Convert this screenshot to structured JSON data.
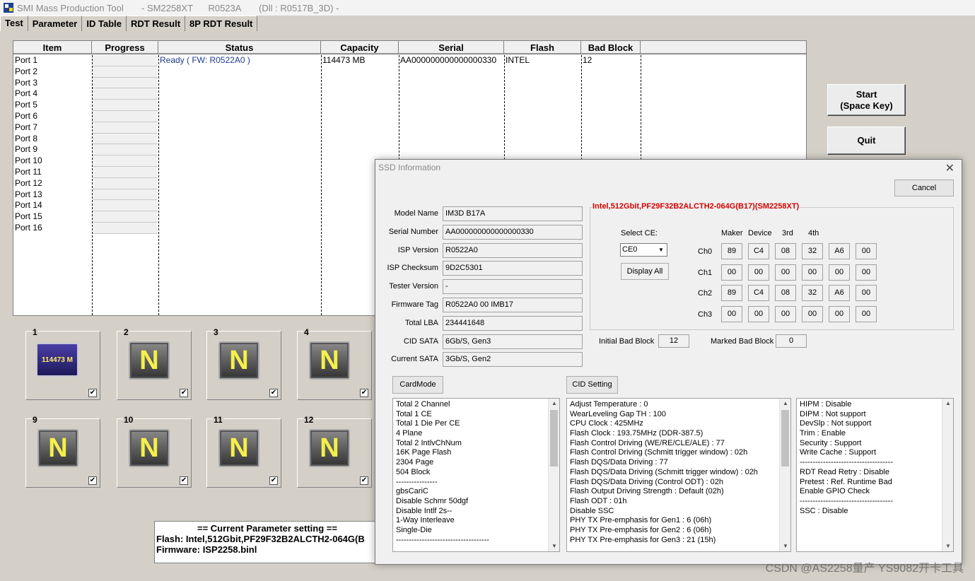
{
  "window": {
    "title": "SMI Mass Production Tool       - SM2258XT      R0523A       (Dll : R0517B_3D) -"
  },
  "tabs": [
    "Test",
    "Parameter",
    "ID Table",
    "RDT Result",
    "8P RDT Result"
  ],
  "table": {
    "headers": {
      "item": "Item",
      "progress": "Progress",
      "status": "Status",
      "capacity": "Capacity",
      "serial": "Serial",
      "flash": "Flash",
      "bad": "Bad Block"
    },
    "rows": [
      {
        "item": "Port 1",
        "status": "Ready ( FW: R0522A0 )",
        "capacity": "114473 MB",
        "serial": "AA000000000000000330",
        "flash": "INTEL",
        "bad": "12"
      },
      {
        "item": "Port 2"
      },
      {
        "item": "Port 3"
      },
      {
        "item": "Port 4"
      },
      {
        "item": "Port 5"
      },
      {
        "item": "Port 6"
      },
      {
        "item": "Port 7"
      },
      {
        "item": "Port 8"
      },
      {
        "item": "Port 9"
      },
      {
        "item": "Port 10"
      },
      {
        "item": "Port 11"
      },
      {
        "item": "Port 12"
      },
      {
        "item": "Port 13"
      },
      {
        "item": "Port 14"
      },
      {
        "item": "Port 15"
      },
      {
        "item": "Port 16"
      }
    ]
  },
  "tiles": [
    {
      "num": "1",
      "icon": "114473 M",
      "checked": "✔"
    },
    {
      "num": "2",
      "icon": "N",
      "checked": "✔"
    },
    {
      "num": "3",
      "icon": "N",
      "checked": "✔"
    },
    {
      "num": "4",
      "icon": "N",
      "checked": "✔"
    },
    {
      "num": "9",
      "icon": "N",
      "checked": "✔"
    },
    {
      "num": "10",
      "icon": "N",
      "checked": "✔"
    },
    {
      "num": "11",
      "icon": "N",
      "checked": "✔"
    },
    {
      "num": "12",
      "icon": "N",
      "checked": "✔"
    }
  ],
  "buttons": {
    "start_line1": "Start",
    "start_line2": "(Space Key)",
    "quit": "Quit"
  },
  "param": {
    "title": "== Current Parameter setting ==",
    "flash": "Flash:   Intel,512Gbit,PF29F32B2ALCTH2-064G(B",
    "firmware": "Firmware:   ISP2258.binl"
  },
  "dialog": {
    "title": "SSD Information",
    "cancel": "Cancel",
    "fields": [
      {
        "label": "Model Name",
        "value": "IM3D B17A"
      },
      {
        "label": "Serial Number",
        "value": "AA000000000000000330"
      },
      {
        "label": "ISP Version",
        "value": "R0522A0"
      },
      {
        "label": "ISP Checksum",
        "value": "9D2C5301"
      },
      {
        "label": "Tester Version",
        "value": "-"
      },
      {
        "label": "Firmware Tag",
        "value": "R0522A0 00 IMB17"
      },
      {
        "label": "Total LBA",
        "value": "234441648"
      },
      {
        "label": "CID SATA",
        "value": "6Gb/S, Gen3"
      },
      {
        "label": "Current SATA",
        "value": "3Gb/S, Gen2"
      }
    ],
    "flash_group_title": "Intel,512Gbit,PF29F32B2ALCTH2-064G(B17)(SM2258XT)",
    "select_ce_label": "Select CE:",
    "select_ce_value": "CE0",
    "display_all": "Display All",
    "id_headers": [
      "Maker",
      "Device",
      "3rd",
      "4th"
    ],
    "channels": [
      {
        "name": "Ch0",
        "bytes": [
          "89",
          "C4",
          "08",
          "32",
          "A6",
          "00"
        ]
      },
      {
        "name": "Ch1",
        "bytes": [
          "00",
          "00",
          "00",
          "00",
          "00",
          "00"
        ]
      },
      {
        "name": "Ch2",
        "bytes": [
          "89",
          "C4",
          "08",
          "32",
          "A6",
          "00"
        ]
      },
      {
        "name": "Ch3",
        "bytes": [
          "00",
          "00",
          "00",
          "00",
          "00",
          "00"
        ]
      }
    ],
    "initial_bad_label": "Initial Bad Block",
    "initial_bad_value": "12",
    "marked_bad_label": "Marked Bad Block",
    "marked_bad_value": "0",
    "cardmode": "CardMode",
    "cid_setting": "CID Setting",
    "list1": [
      "Total 2 Channel",
      "Total 1 CE",
      "Total 1 Die Per CE",
      "4 Plane",
      "Total 2 IntlvChNum",
      "16K Page Flash",
      "2304 Page",
      "504 Block",
      "----------------",
      "gbsCariC",
      "Disable Schmr 50dgf",
      "Disable Intlf 2s--",
      "1-Way Interleave",
      "Single-Die",
      "------------------------------------"
    ],
    "list2": [
      "Adjust Temperature : 0",
      "WearLeveling Gap TH : 100",
      "CPU Clock : 425MHz",
      "Flash Clock : 193.75MHz (DDR-387.5)",
      "Flash Control Driving (WE/RE/CLE/ALE) : 77",
      "Flash Control Driving (Schmitt trigger window) : 02h",
      "Flash DQS/Data Driving : 77",
      "Flash DQS/Data Driving (Schmitt trigger window) : 02h",
      "Flash DQS/Data Driving (Control ODT) : 02h",
      "Flash Output Driving Strength : Default (02h)",
      "Flash ODT : 01h",
      "Disable SSC",
      "PHY TX Pre-emphasis for Gen1 : 6 (06h)",
      "PHY TX Pre-emphasis for Gen2 : 6 (06h)",
      "PHY TX Pre-emphasis for Gen3 : 21 (15h)"
    ],
    "list3": [
      "HIPM : Disable",
      "DIPM : Not support",
      "DevSlp : Not support",
      "Trim : Enable",
      "Security : Support",
      "Write Cache : Support",
      "------------------------------------",
      "RDT Read Retry : Disable",
      "Pretest : Ref. Runtime Bad",
      "Enable GPIO Check",
      "------------------------------------",
      "SSC : Disable"
    ]
  },
  "watermark": "CSDN @AS2258量产 YS9082开卡工具"
}
